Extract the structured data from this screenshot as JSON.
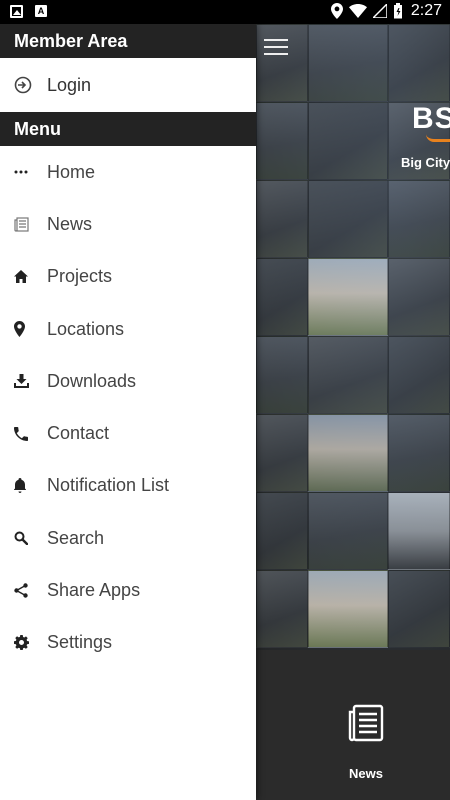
{
  "status_bar": {
    "time": "2:27",
    "left_icons": [
      "image-icon",
      "a-app-icon"
    ],
    "right_icons": [
      "location-icon",
      "wifi-icon",
      "cell-signal-icon",
      "battery-icon"
    ],
    "a_glyph": "A"
  },
  "drawer": {
    "member_header": "Member Area",
    "login_label": "Login",
    "menu_header": "Menu",
    "items": [
      {
        "label": "Home",
        "icon": "dots-icon"
      },
      {
        "label": "News",
        "icon": "newspaper-icon"
      },
      {
        "label": "Projects",
        "icon": "house-icon"
      },
      {
        "label": "Locations",
        "icon": "location-pin-icon"
      },
      {
        "label": "Downloads",
        "icon": "download-icon"
      },
      {
        "label": "Contact",
        "icon": "phone-icon"
      },
      {
        "label": "Notification List",
        "icon": "bell-icon"
      },
      {
        "label": "Search",
        "icon": "search-icon"
      },
      {
        "label": "Share Apps",
        "icon": "share-icon"
      },
      {
        "label": "Settings",
        "icon": "gear-icon"
      }
    ]
  },
  "app_screen": {
    "logo_text": "BS",
    "tagline": "Big City",
    "bottom_nav": {
      "news_label": "News"
    }
  },
  "colors": {
    "drawer_header_bg": "#232323",
    "accent_orange": "#e8821e",
    "bottom_nav_bg": "#2b2b2b"
  }
}
